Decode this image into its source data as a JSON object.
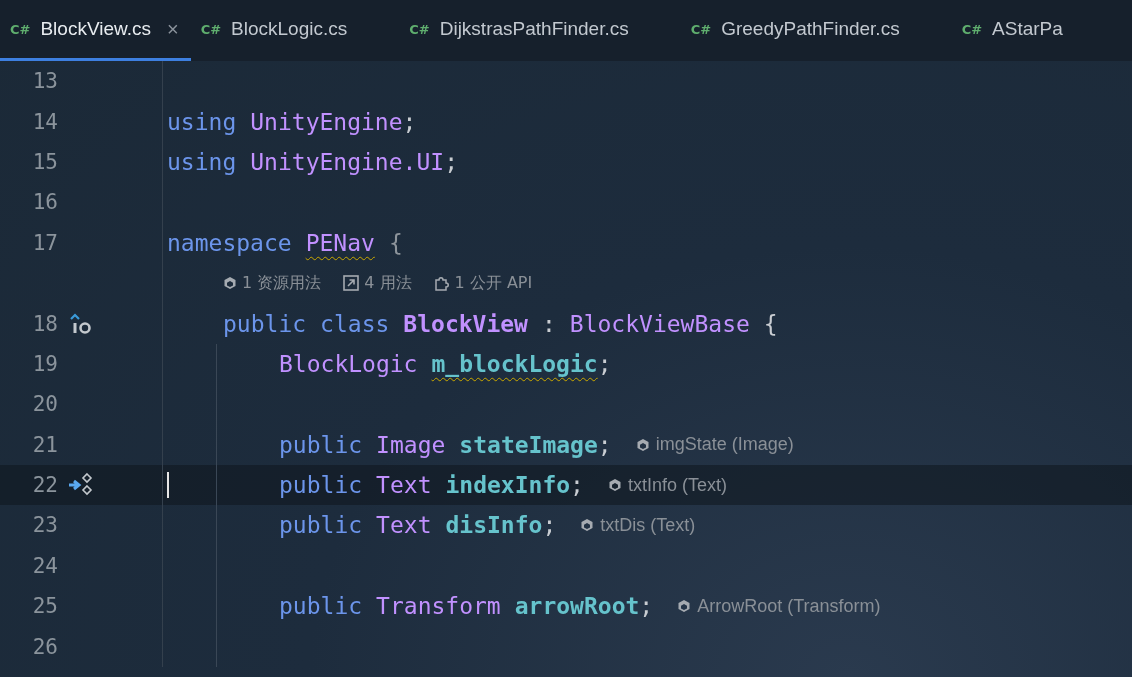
{
  "tabs": [
    {
      "lang": "C#",
      "label": "BlockView.cs",
      "selected": true,
      "close": "×"
    },
    {
      "lang": "C#",
      "label": "BlockLogic.cs",
      "selected": false
    },
    {
      "lang": "C#",
      "label": "DijkstrasPathFinder.cs",
      "selected": false
    },
    {
      "lang": "C#",
      "label": "GreedyPathFinder.cs",
      "selected": false
    },
    {
      "lang": "C#",
      "label": "AStarPa",
      "selected": false
    }
  ],
  "code": {
    "lines": [
      {
        "kind": "code",
        "number": "13",
        "current": false
      },
      {
        "kind": "code",
        "number": "14",
        "current": false,
        "tokens": [
          {
            "text": "using",
            "kind": "keyword"
          },
          {
            "text": "UnityEngine",
            "kind": "type"
          },
          {
            "text": ";",
            "kind": "punct"
          }
        ]
      },
      {
        "kind": "code",
        "number": "15",
        "current": false,
        "tokens": [
          {
            "text": "using",
            "kind": "keyword"
          },
          {
            "text": "UnityEngine.UI",
            "kind": "type"
          },
          {
            "text": ";",
            "kind": "punct"
          }
        ]
      },
      {
        "kind": "code",
        "number": "16",
        "current": false
      },
      {
        "kind": "code",
        "number": "17",
        "current": false,
        "tokens": [
          {
            "text": "namespace",
            "kind": "keyword"
          },
          {
            "text": "PENav",
            "kind": "type-warning"
          },
          {
            "text": "{",
            "kind": "brace"
          }
        ],
        "children": [
          {
            "kind": "lens",
            "items": [
              {
                "text": "1 资源用法"
              },
              {
                "text": "4 用法"
              },
              {
                "text": "1 公开 API"
              }
            ]
          },
          {
            "kind": "implemented",
            "number": "18",
            "current": false,
            "tokens": [
              {
                "text": "public",
                "kind": "keyword"
              },
              {
                "text": "class",
                "kind": "keyword"
              },
              {
                "text": "BlockView",
                "kind": "type-bold"
              },
              {
                "text": ":",
                "kind": "operator"
              },
              {
                "text": "BlockViewBase",
                "kind": "type"
              },
              {
                "text": "{",
                "kind": "operator"
              }
            ],
            "children": [
              {
                "kind": "code",
                "number": "19",
                "current": false,
                "tokens": [
                  {
                    "text": "BlockLogic",
                    "kind": "type"
                  },
                  {
                    "text": "m_blockLogic",
                    "kind": "field-warning"
                  },
                  {
                    "text": ";",
                    "kind": "punct"
                  }
                ]
              },
              {
                "kind": "code",
                "number": "20",
                "current": false
              },
              {
                "kind": "code",
                "number": "21",
                "current": false,
                "tokens": [
                  {
                    "text": "public",
                    "kind": "keyword"
                  },
                  {
                    "text": "Image",
                    "kind": "type"
                  },
                  {
                    "text": "stateImage",
                    "kind": "field"
                  },
                  {
                    "text": ";",
                    "kind": "punct"
                  }
                ],
                "hint": "imgState (Image)"
              },
              {
                "kind": "overriding",
                "number": "22",
                "current": true,
                "tokens": [
                  {
                    "text": "public",
                    "kind": "keyword"
                  },
                  {
                    "text": "Text",
                    "kind": "type"
                  },
                  {
                    "text": "indexInfo",
                    "kind": "field"
                  },
                  {
                    "text": ";",
                    "kind": "punct"
                  }
                ],
                "hint": "txtInfo (Text)"
              },
              {
                "kind": "code",
                "number": "23",
                "current": false,
                "tokens": [
                  {
                    "text": "public",
                    "kind": "keyword"
                  },
                  {
                    "text": "Text",
                    "kind": "type"
                  },
                  {
                    "text": "disInfo",
                    "kind": "field"
                  },
                  {
                    "text": ";",
                    "kind": "punct"
                  }
                ],
                "hint": "txtDis (Text)"
              },
              {
                "kind": "code",
                "number": "24",
                "current": false
              },
              {
                "kind": "code",
                "number": "25",
                "current": false,
                "tokens": [
                  {
                    "text": "public",
                    "kind": "keyword"
                  },
                  {
                    "text": "Transform",
                    "kind": "type"
                  },
                  {
                    "text": "arrowRoot",
                    "kind": "field"
                  },
                  {
                    "text": ";",
                    "kind": "punct"
                  }
                ],
                "hint": "ArrowRoot (Transform)"
              },
              {
                "kind": "code",
                "number": "26",
                "current": false
              }
            ]
          }
        ]
      }
    ]
  }
}
